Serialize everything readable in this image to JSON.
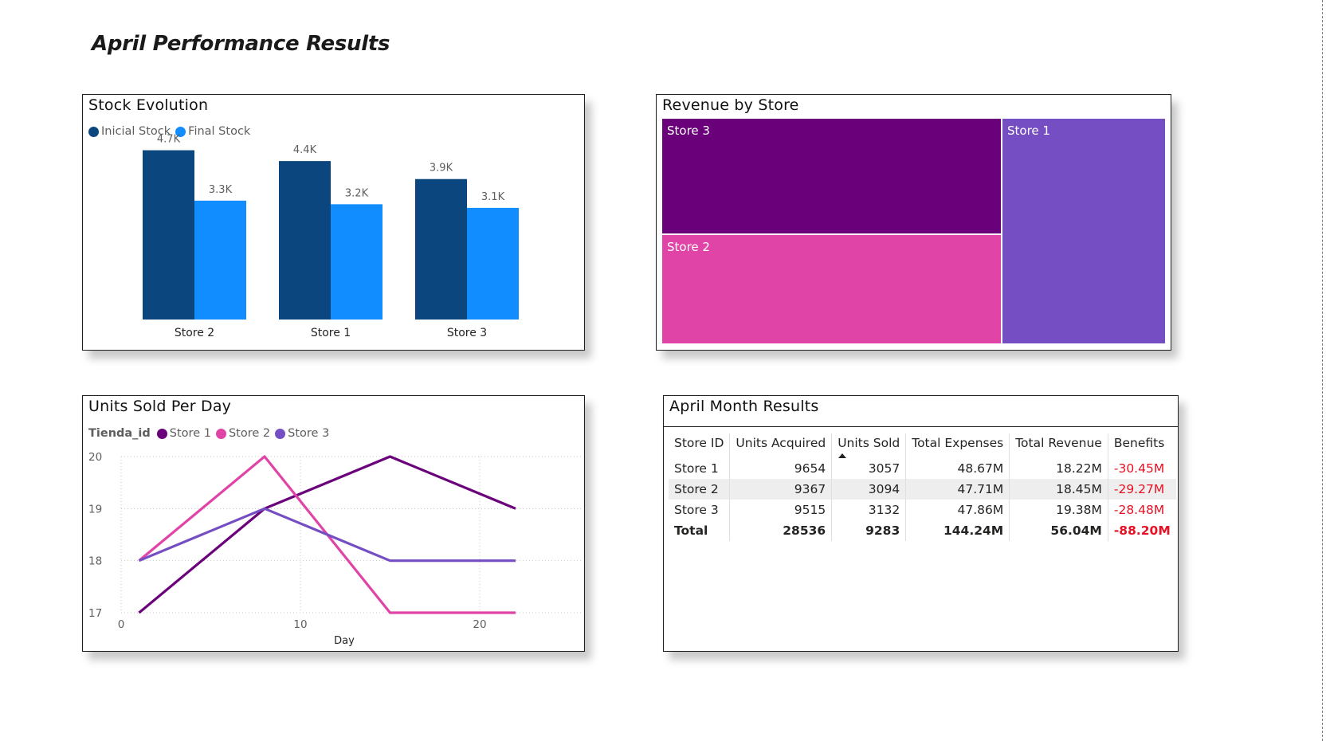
{
  "page": {
    "title": "April Performance Results"
  },
  "stock_card": {
    "title": "Stock Evolution",
    "legend": [
      {
        "label": "Inicial Stock",
        "color": "#0b477e"
      },
      {
        "label": "Final Stock",
        "color": "#118dff"
      }
    ]
  },
  "revenue_card": {
    "title": "Revenue by Store",
    "cells": [
      {
        "label": "Store 3",
        "color": "#6b007b"
      },
      {
        "label": "Store 2",
        "color": "#e044a7"
      },
      {
        "label": "Store 1",
        "color": "#744ec2"
      }
    ]
  },
  "units_card": {
    "title": "Units Sold Per Day",
    "legend_title": "Tienda_id",
    "legend": [
      {
        "label": "Store 1",
        "color": "#6b007b"
      },
      {
        "label": "Store 2",
        "color": "#e044a7"
      },
      {
        "label": "Store 3",
        "color": "#744ec2"
      }
    ]
  },
  "results_card": {
    "title": "April Month Results",
    "headers": [
      "Store ID",
      "Units Acquired",
      "Units Sold",
      "Total Expenses",
      "Total Revenue",
      "Benefits"
    ],
    "rows": [
      [
        "Store 1",
        "9654",
        "3057",
        "48.67M",
        "18.22M",
        "-30.45M"
      ],
      [
        "Store 2",
        "9367",
        "3094",
        "47.71M",
        "18.45M",
        "-29.27M"
      ],
      [
        "Store 3",
        "9515",
        "3132",
        "47.86M",
        "19.38M",
        "-28.48M"
      ]
    ],
    "total": [
      "Total",
      "28536",
      "9283",
      "144.24M",
      "56.04M",
      "-88.20M"
    ],
    "negative_color": "#e81123"
  },
  "chart_data": [
    {
      "type": "bar",
      "title": "Stock Evolution",
      "categories": [
        "Store 2",
        "Store 1",
        "Store 3"
      ],
      "series": [
        {
          "name": "Inicial Stock",
          "values": [
            4700,
            4400,
            3900
          ],
          "labels": [
            "4.7K",
            "4.4K",
            "3.9K"
          ],
          "color": "#0b477e"
        },
        {
          "name": "Final Stock",
          "values": [
            3300,
            3200,
            3100
          ],
          "labels": [
            "3.3K",
            "3.2K",
            "3.1K"
          ],
          "color": "#118dff"
        }
      ],
      "ylim": [
        0,
        5000
      ],
      "grid": false,
      "legend": "top-left"
    },
    {
      "type": "treemap",
      "title": "Revenue by Store",
      "categories": [
        "Store 3",
        "Store 2",
        "Store 1"
      ],
      "values": [
        19.38,
        18.45,
        18.22
      ]
    },
    {
      "type": "line",
      "title": "Units Sold Per Day",
      "xlabel": "Day",
      "ylabel": "",
      "xlim": [
        0,
        23
      ],
      "ylim": [
        17,
        20
      ],
      "xticks": [
        0,
        10,
        20
      ],
      "yticks": [
        17,
        18,
        19,
        20
      ],
      "x": [
        1,
        8,
        15,
        22
      ],
      "series": [
        {
          "name": "Store 1",
          "values": [
            17,
            19,
            20,
            19
          ],
          "color": "#6b007b"
        },
        {
          "name": "Store 2",
          "values": [
            18,
            20,
            17,
            17
          ],
          "color": "#e044a7"
        },
        {
          "name": "Store 3",
          "values": [
            18,
            19,
            18,
            18
          ],
          "color": "#744ec2"
        }
      ],
      "grid": true,
      "legend": "top-left"
    }
  ]
}
